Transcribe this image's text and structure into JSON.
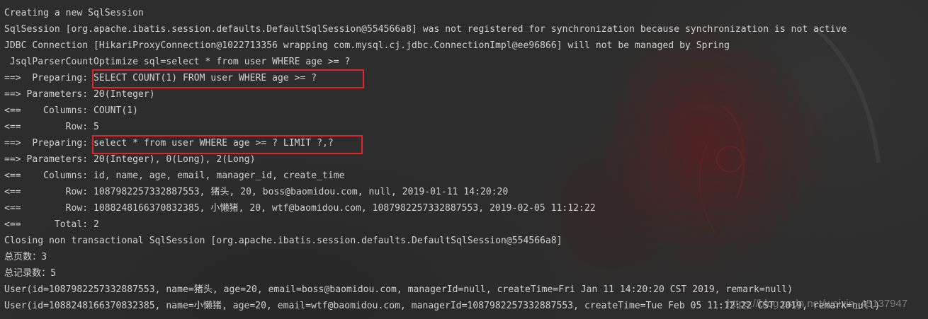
{
  "console": {
    "lines": [
      "Creating a new SqlSession",
      "SqlSession [org.apache.ibatis.session.defaults.DefaultSqlSession@554566a8] was not registered for synchronization because synchronization is not active",
      "JDBC Connection [HikariProxyConnection@1022713356 wrapping com.mysql.cj.jdbc.ConnectionImpl@ee96866] will not be managed by Spring",
      " JsqlParserCountOptimize sql=select * from user WHERE age >= ?",
      "==>  Preparing: SELECT COUNT(1) FROM user WHERE age >= ?",
      "==> Parameters: 20(Integer)",
      "<==    Columns: COUNT(1)",
      "<==        Row: 5",
      "==>  Preparing: select * from user WHERE age >= ? LIMIT ?,?",
      "==> Parameters: 20(Integer), 0(Long), 2(Long)",
      "<==    Columns: id, name, age, email, manager_id, create_time",
      "<==        Row: 1087982257332887553, 猪头, 20, boss@baomidou.com, null, 2019-01-11 14:20:20",
      "<==        Row: 1088248166370832385, 小懒猪, 20, wtf@baomidou.com, 1087982257332887553, 2019-02-05 11:12:22",
      "<==      Total: 2",
      "Closing non transactional SqlSession [org.apache.ibatis.session.defaults.DefaultSqlSession@554566a8]",
      "总页数：3",
      "总记录数：5",
      "User(id=1087982257332887553, name=猪头, age=20, email=boss@baomidou.com, managerId=null, createTime=Fri Jan 11 14:20:20 CST 2019, remark=null)",
      "User(id=1088248166370832385, name=小懒猪, age=20, email=wtf@baomidou.com, managerId=1087982257332887553, createTime=Tue Feb 05 11:12:22 CST 2019, remark=null)"
    ]
  },
  "watermark": "https://blog.csdn.net/weixin_45137947",
  "colors": {
    "text": "#d2d2d2",
    "background": "#2b2b2b",
    "highlight_border": "#e0262b"
  }
}
